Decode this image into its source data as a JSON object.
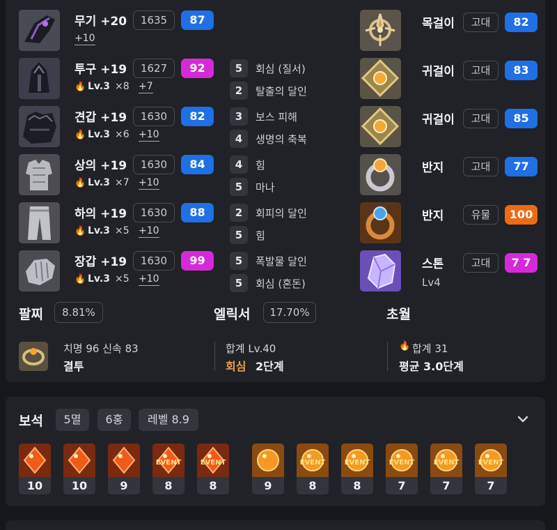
{
  "colors": {
    "blue": "#1f6fe5",
    "magenta": "#d62ad9",
    "orange": "#ef6a14",
    "panel": "#202227"
  },
  "equipment": [
    {
      "name": "무기 +20",
      "level": "1635",
      "quality": "87",
      "quality_color": "blue",
      "sub_extra": "+10",
      "icon": "weapon-gauntlet-icon"
    },
    {
      "name": "투구 +19",
      "level": "1627",
      "quality": "92",
      "quality_color": "magenta",
      "sub_lv": "Lv.3",
      "sub_mult": "×8",
      "sub_extra": "+7",
      "icon": "helmet-icon"
    },
    {
      "name": "견갑 +19",
      "level": "1630",
      "quality": "82",
      "quality_color": "blue",
      "sub_lv": "Lv.3",
      "sub_mult": "×6",
      "sub_extra": "+10",
      "icon": "shoulder-icon"
    },
    {
      "name": "상의 +19",
      "level": "1630",
      "quality": "84",
      "quality_color": "blue",
      "sub_lv": "Lv.3",
      "sub_mult": "×7",
      "sub_extra": "+10",
      "icon": "chest-armor-icon"
    },
    {
      "name": "하의 +19",
      "level": "1630",
      "quality": "88",
      "quality_color": "blue",
      "sub_lv": "Lv.3",
      "sub_mult": "×5",
      "sub_extra": "+10",
      "icon": "pants-icon"
    },
    {
      "name": "장갑 +19",
      "level": "1630",
      "quality": "99",
      "quality_color": "magenta",
      "sub_lv": "Lv.3",
      "sub_mult": "×5",
      "sub_extra": "+10",
      "icon": "gloves-icon"
    }
  ],
  "engravings": [
    {
      "num": "5",
      "name": "회심 (질서)"
    },
    {
      "num": "2",
      "name": "탈출의 달인"
    },
    {
      "num": "3",
      "name": "보스 피해"
    },
    {
      "num": "4",
      "name": "생명의 축복"
    },
    {
      "num": "4",
      "name": "힘"
    },
    {
      "num": "5",
      "name": "마나"
    },
    {
      "num": "2",
      "name": "회피의 달인"
    },
    {
      "num": "5",
      "name": "힘"
    },
    {
      "num": "5",
      "name": "폭발물 달인"
    },
    {
      "num": "5",
      "name": "회심 (혼돈)"
    }
  ],
  "accessories": [
    {
      "name": "목걸이",
      "grade": "고대",
      "quality": "82",
      "quality_color": "blue",
      "icon": "necklace-icon"
    },
    {
      "name": "귀걸이",
      "grade": "고대",
      "quality": "83",
      "quality_color": "blue",
      "icon": "earring-icon"
    },
    {
      "name": "귀걸이",
      "grade": "고대",
      "quality": "85",
      "quality_color": "blue",
      "icon": "earring-icon"
    },
    {
      "name": "반지",
      "grade": "고대",
      "quality": "77",
      "quality_color": "blue",
      "icon": "ring-icon"
    },
    {
      "name": "반지",
      "grade": "유물",
      "quality": "100",
      "quality_color": "orange",
      "icon": "ring-icon"
    },
    {
      "name": "스톤",
      "grade": "고대",
      "quality": "7 7",
      "quality_color": "magenta",
      "sub": "Lv4",
      "icon": "ability-stone-icon"
    }
  ],
  "bracelet": {
    "title": "팔찌",
    "percent": "8.81%",
    "stats": "치명 96  신속 83",
    "effect": "결투"
  },
  "elixir": {
    "title": "엘릭서",
    "percent": "17.70%",
    "total": "합계 Lv.40",
    "effect_key": "회심",
    "effect_value": "2단계"
  },
  "transcend": {
    "title": "초월",
    "total": "합계 31",
    "average": "평균 3.0단계"
  },
  "gems": {
    "title": "보석",
    "tags": [
      "5멸",
      "6홍",
      "레벨 8.9"
    ],
    "items": [
      {
        "level": "10",
        "type": "red",
        "event": false
      },
      {
        "level": "10",
        "type": "red",
        "event": false
      },
      {
        "level": "9",
        "type": "red",
        "event": false
      },
      {
        "level": "8",
        "type": "red",
        "event": true,
        "event_label": "EVENT"
      },
      {
        "level": "8",
        "type": "red",
        "event": true,
        "event_label": "EVENT"
      },
      {
        "level": "9",
        "type": "orange",
        "event": false
      },
      {
        "level": "8",
        "type": "orange",
        "event": true,
        "event_label": "EVENT"
      },
      {
        "level": "8",
        "type": "orange",
        "event": true,
        "event_label": "EVENT"
      },
      {
        "level": "7",
        "type": "orange",
        "event": true,
        "event_label": "EVENT"
      },
      {
        "level": "7",
        "type": "orange",
        "event": true,
        "event_label": "EVENT"
      },
      {
        "level": "7",
        "type": "orange",
        "event": true,
        "event_label": "EVENT"
      }
    ]
  }
}
